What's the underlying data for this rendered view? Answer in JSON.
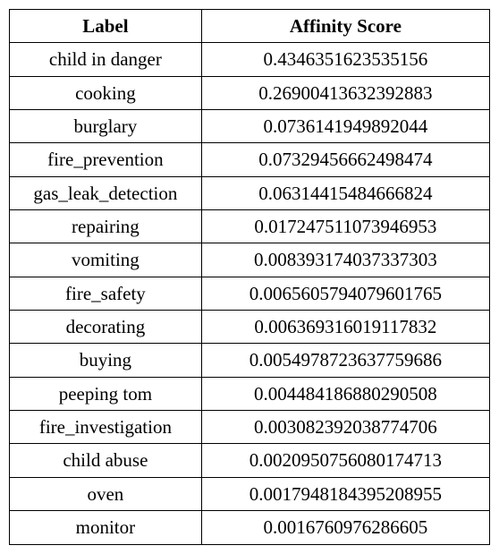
{
  "headers": {
    "label": "Label",
    "score": "Affinity Score"
  },
  "rows": [
    {
      "label": "child in danger",
      "score": "0.4346351623535156"
    },
    {
      "label": "cooking",
      "score": "0.26900413632392883"
    },
    {
      "label": "burglary",
      "score": "0.0736141949892044"
    },
    {
      "label": "fire_prevention",
      "score": "0.07329456662498474"
    },
    {
      "label": "gas_leak_detection",
      "score": "0.06314415484666824"
    },
    {
      "label": "repairing",
      "score": "0.017247511073946953"
    },
    {
      "label": "vomiting",
      "score": "0.008393174037337303"
    },
    {
      "label": "fire_safety",
      "score": "0.0065605794079601765"
    },
    {
      "label": "decorating",
      "score": "0.006369316019117832"
    },
    {
      "label": "buying",
      "score": "0.0054978723637759686"
    },
    {
      "label": "peeping tom",
      "score": "0.004484186880290508"
    },
    {
      "label": "fire_investigation",
      "score": "0.003082392038774706"
    },
    {
      "label": "child abuse",
      "score": "0.0020950756080174713"
    },
    {
      "label": "oven",
      "score": "0.0017948184395208955"
    },
    {
      "label": "monitor",
      "score": "0.0016760976286605"
    }
  ]
}
